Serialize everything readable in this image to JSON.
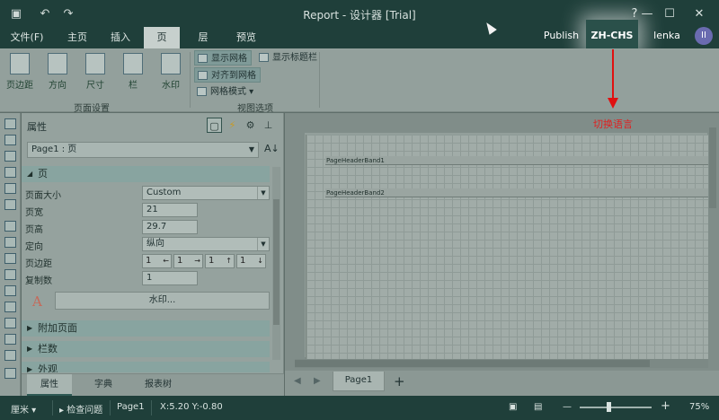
{
  "window": {
    "title": "Report - 设计器 [Trial]",
    "quick_access": [
      {
        "icon": "save-icon",
        "glyph": "🖫"
      },
      {
        "icon": "undo-icon",
        "glyph": "↶"
      },
      {
        "icon": "redo-icon",
        "glyph": "↷"
      }
    ],
    "controls": {
      "help": "?",
      "minimize": "—",
      "maximize": "☐",
      "close": "✕"
    }
  },
  "ribbon_tabs": [
    "文件(F)",
    "主页",
    "插入",
    "页",
    "层",
    "预览"
  ],
  "ribbon_active_tab": "页",
  "header_buttons": {
    "publish": "Publish",
    "language": "ZH-CHS",
    "user": "lenka lenka",
    "avatar": "II"
  },
  "ribbon": {
    "page_setup": {
      "items": [
        "页边距",
        "方向",
        "尺寸",
        "栏",
        "水印"
      ],
      "group_label": "页面设置"
    },
    "view_options": {
      "show_grid": "显示网格",
      "show_headers": "显示标题栏",
      "snap_to_grid": "对齐到网格",
      "grid_mode": "网格模式",
      "group_label": "视图选项"
    }
  },
  "properties": {
    "title": "属性",
    "selector": "Page1 : 页",
    "category_page": "页",
    "rows": {
      "page_size_label": "页面大小",
      "page_size_value": "Custom",
      "width_label": "页宽",
      "width_value": "21",
      "height_label": "页高",
      "height_value": "29.7",
      "orientation_label": "定向",
      "orientation_value": "纵向",
      "margins_label": "页边距",
      "margins_values": [
        "1",
        "1",
        "1",
        "1"
      ],
      "copies_label": "复制数",
      "copies_value": "1"
    },
    "watermark_button": "水印...",
    "watermark_icon_letter": "A",
    "category_extra": "附加页面",
    "category_columns": "栏数",
    "category_appearance": "外观",
    "bottom_tabs": [
      "属性",
      "字典",
      "报表树"
    ]
  },
  "design": {
    "bands": [
      "PageHeaderBand1",
      "PageHeaderBand2"
    ],
    "page_tab": "Page1",
    "add_page": "+"
  },
  "annotation": {
    "text": "切换语言",
    "color": "#e01010"
  },
  "status": {
    "unit": "厘米",
    "check_issues": "检查问题",
    "page": "Page1",
    "coords": "X:5.20 Y:-0.80",
    "zoom_minus": "—",
    "zoom_plus": "+",
    "zoom": "75%"
  }
}
